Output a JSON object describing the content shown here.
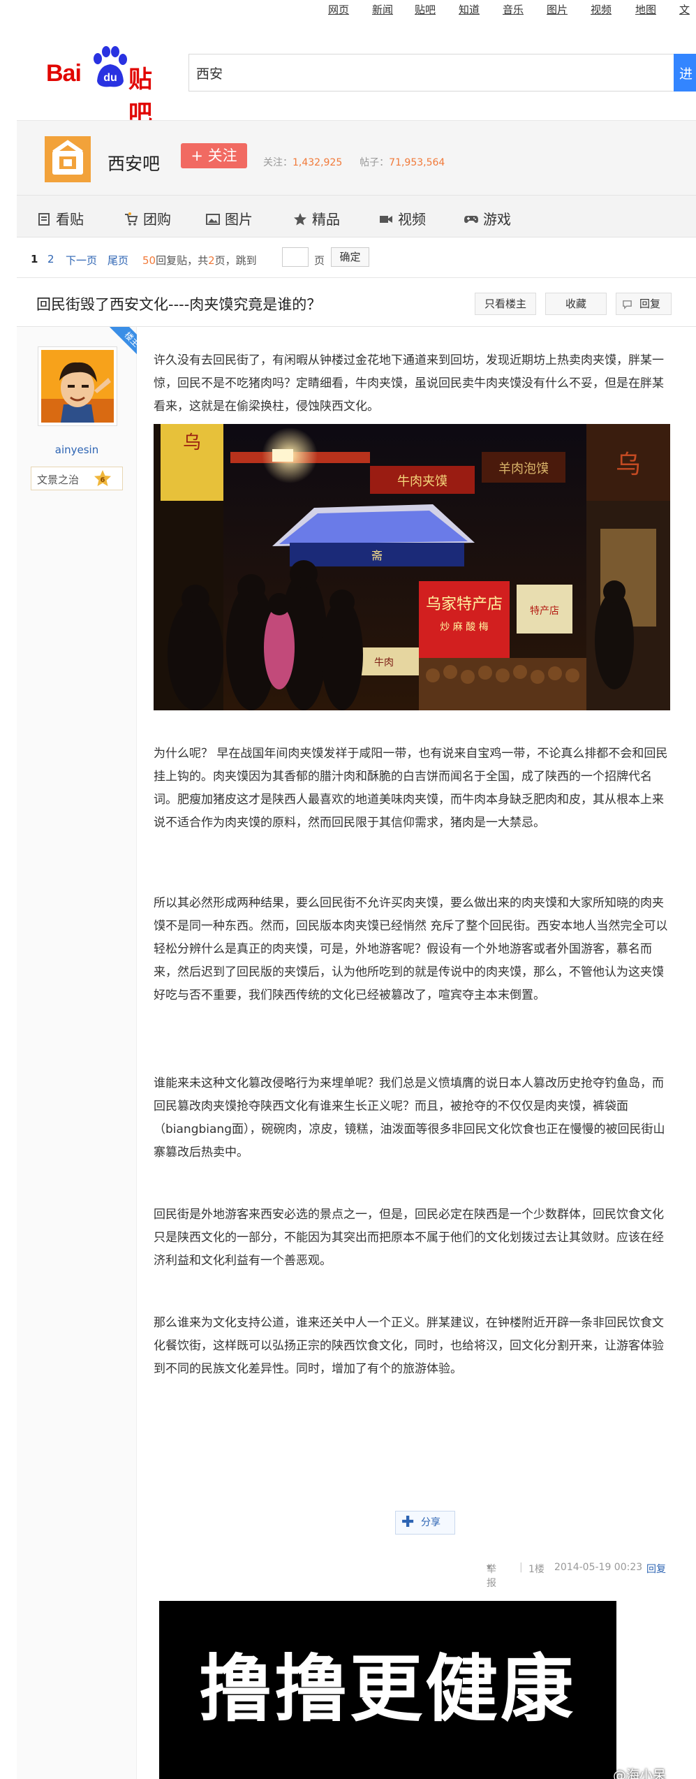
{
  "topnav": [
    "网页",
    "新闻",
    "贴吧",
    "知道",
    "音乐",
    "图片",
    "视频",
    "地图",
    "文"
  ],
  "brand": {
    "bai": "Bai",
    "du": "du",
    "tieba": "贴吧"
  },
  "search": {
    "value": "西安",
    "button": "进"
  },
  "forum": {
    "name": "西安吧",
    "follow": "+ 关注",
    "follow_label": "关注：",
    "follow_count": "1,432,925",
    "posts_label": "帖子：",
    "posts_count": "71,953,564"
  },
  "tabs": [
    {
      "label": "看贴",
      "icon": "post-icon"
    },
    {
      "label": "团购",
      "icon": "cart-icon"
    },
    {
      "label": "图片",
      "icon": "image-icon"
    },
    {
      "label": "精品",
      "icon": "star-icon"
    },
    {
      "label": "视频",
      "icon": "video-icon"
    },
    {
      "label": "游戏",
      "icon": "gamepad-icon"
    }
  ],
  "pager": {
    "current": "1",
    "page2": "2",
    "next": "下一页",
    "last": "尾页",
    "reply_count": "50",
    "reply_label": "回复贴，共",
    "page_count": "2",
    "page_suffix": "页，跳到",
    "page_unit": "页",
    "ok": "确定"
  },
  "thread": {
    "title": "回民街毁了西安文化----肉夹馍究竟是谁的？",
    "only_op": "只看楼主",
    "collect": "收藏",
    "reply": "回复"
  },
  "user": {
    "badge": "楼主",
    "name": "ainyesin",
    "title": "文景之治",
    "level": "6"
  },
  "post": {
    "paragraphs": [
      "许久没有去回民街了，有闲暇从钟楼过金花地下通道来到回坊，发现近期坊上热卖肉夹馍，胖某一惊，回民不是不吃猪肉吗？定睛细看，牛肉夹馍，虽说回民卖牛肉夹馍没有什么不妥，但是在胖某看来，这就是在偷梁换柱，侵蚀陕西文化。",
      "为什么呢？ 早在战国年间肉夹馍发祥于咸阳一带，也有说来自宝鸡一带，不论真么排都不会和回民挂上钩的。肉夹馍因为其香郁的腊汁肉和酥脆的白吉饼而闻名于全国，成了陕西的一个招牌代名词。肥瘦加猪皮这才是陕西人最喜欢的地道美味肉夹馍，而牛肉本身缺乏肥肉和皮，其从根本上来说不适合作为肉夹馍的原料，然而回民限于其信仰需求，猪肉是一大禁忌。",
      "所以其必然形成两种结果，要么回民街不允许买肉夹馍，要么做出来的肉夹馍和大家所知晓的肉夹馍不是同一种东西。然而，回民版本肉夹馍已经悄然 充斥了整个回民街。西安本地人当然完全可以轻松分辨什么是真正的肉夹馍，可是，外地游客呢？假设有一个外地游客或者外国游客，慕名而来，然后迟到了回民版的夹馍后，认为他所吃到的就是传说中的肉夹馍，那么，不管他认为这夹馍好吃与否不重要，我们陕西传统的文化已经被篡改了，喧宾夺主本末倒置。",
      "谁能来未这种文化篡改侵略行为来埋单呢？我们总是义愤填膺的说日本人篡改历史抢夺钓鱼岛，而回民篡改肉夹馍抢夺陕西文化有谁来生长正义呢？而且，被抢夺的不仅仅是肉夹馍，裤袋面（biangbiang面），碗碗肉，凉皮，镜糕，油泼面等很多非回民文化饮食也正在慢慢的被回民街山寨篡改后热卖中。",
      "回民街是外地游客来西安必选的景点之一，但是，回民必定在陕西是一个少数群体，回民饮食文化只是陕西文化的一部分，不能因为其突出而把原本不属于他们的文化划拨过去让其敛财。应该在经济利益和文化利益有一个善恶观。",
      "那么谁来为文化支持公道，谁来还关中人一个正义。胖某建议，在钟楼附近开辟一条非回民饮食文化餐饮街，这样既可以弘扬正宗的陕西饮食文化，同时，也给将汉，回文化分割开来，让游客体验到不同的民族文化差异性。同时，增加了有个的旅游体验。"
    ],
    "photo_signs": [
      "乌",
      "乌",
      "特产店",
      "牛肉夹馍",
      "羊肉泡馍",
      "乌家特产店",
      "炒 麻 酸 梅",
      "斋",
      "牛肉"
    ],
    "share": "分享"
  },
  "meta": {
    "report": "举报",
    "floor": "1楼",
    "time": "2014-05-19 00:23",
    "reply": "回复"
  },
  "signature": "撸撸更健康",
  "watermark": "@海小呆"
}
